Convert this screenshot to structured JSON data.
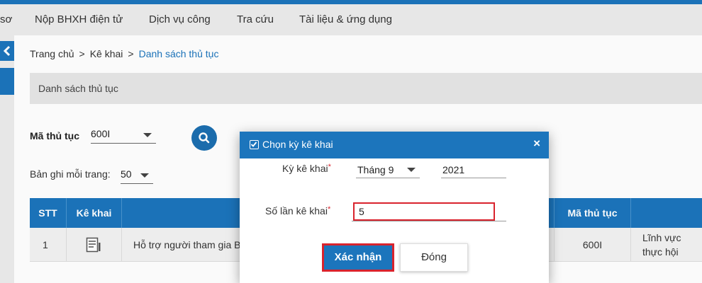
{
  "nav": {
    "partial_item": "sơ",
    "items": [
      "Nộp BHXH điện tử",
      "Dịch vụ công",
      "Tra cứu",
      "Tài liệu & ứng dụng"
    ]
  },
  "breadcrumb": {
    "home": "Trang chủ",
    "parent": "Kê khai",
    "current": "Danh sách thủ tục",
    "separator": ">"
  },
  "section_title": "Danh sách thủ tục",
  "filters": {
    "procedure_code_label": "Mã thủ tục",
    "procedure_code_value": "600I",
    "per_page_label": "Bản ghi mỗi trang:",
    "per_page_value": "50"
  },
  "table": {
    "headers": {
      "stt": "STT",
      "ke_khai": "Kê khai",
      "ma_thu_tuc": "Mã thủ tục"
    },
    "rows": [
      {
        "stt": "1",
        "name": "Hỗ trợ người tham gia B",
        "code": "600I",
        "field": "Lĩnh vực thực hội"
      }
    ]
  },
  "modal": {
    "title": "Chọn kỳ kê khai",
    "period_label": "Kỳ kê khai",
    "month_value": "Tháng 9",
    "year_value": "2021",
    "count_label": "Số lần kê khai",
    "count_value": "5",
    "required_mark": "*",
    "confirm_label": "Xác nhận",
    "close_label": "Đóng",
    "close_icon": "×"
  },
  "colors": {
    "primary": "#1c75bc",
    "highlight": "#d9232d"
  }
}
